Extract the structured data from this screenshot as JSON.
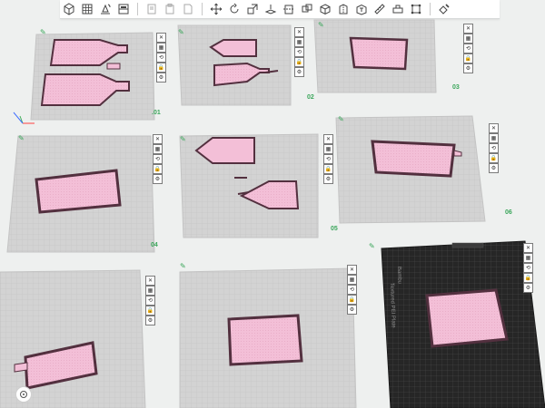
{
  "toolbar": {
    "left": [
      "add-object",
      "arrange-grid",
      "auto-orient",
      "split-plate"
    ],
    "middle": [
      "copy-object",
      "paste-object",
      "delete-object",
      "move-tool",
      "rotate-tool",
      "scale-tool",
      "place-on-face",
      "cut-tool",
      "mesh-boolean",
      "support-paint",
      "seam-paint",
      "text-tool",
      "measure-tool",
      "assembly-view",
      "color-paint"
    ],
    "right": [
      "slice-settings"
    ]
  },
  "plates": [
    {
      "id": "plate-1",
      "label": ".01"
    },
    {
      "id": "plate-2",
      "label": "02"
    },
    {
      "id": "plate-3",
      "label": "03"
    },
    {
      "id": "plate-4",
      "label": "04"
    },
    {
      "id": "plate-5",
      "label": "05"
    },
    {
      "id": "plate-6",
      "label": "06"
    },
    {
      "id": "plate-7",
      "label": ""
    },
    {
      "id": "plate-8",
      "label": ""
    },
    {
      "id": "plate-9",
      "label": ""
    }
  ],
  "dark_plate": {
    "brand": "Bambu",
    "model": "Textured PEI Plate"
  },
  "colors": {
    "model": "#f3bfd7",
    "model_edge": "#53303f",
    "plate": "#cfcfcf",
    "plate_dark": "#262626",
    "accent_green": "#3aa65a"
  }
}
